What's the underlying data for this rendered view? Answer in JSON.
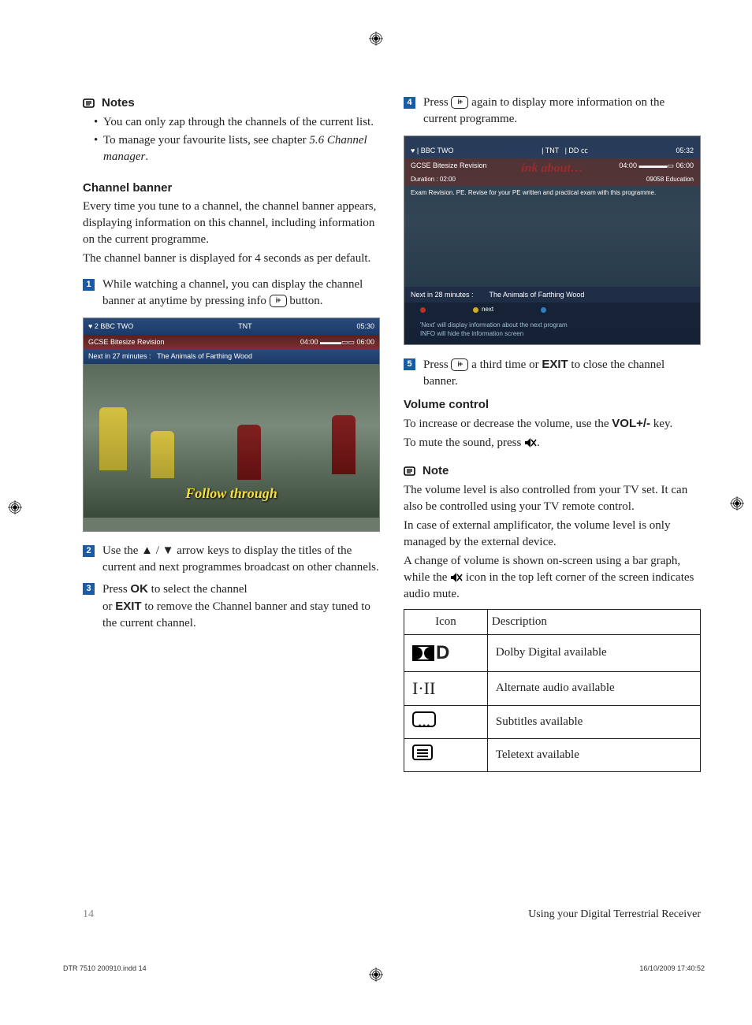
{
  "left": {
    "notesTitle": "Notes",
    "bullets": [
      "You can only zap through the channels of the current list.",
      "To manage your favourite lists, see chapter "
    ],
    "bulletRef": "5.6 Channel manager",
    "bannerHeading": "Channel banner",
    "bannerP1": "Every time you tune to a channel, the channel banner appears, displaying information on this channel, including information on the current programme.",
    "bannerP2": "The channel banner is displayed for 4 seconds as per default.",
    "step1_a": "While watching a channel, you can display the channel banner at anytime by pressing info ",
    "step1_b": " button.",
    "shot1": {
      "chLabel": "2 BBC TWO",
      "tnt": "TNT",
      "time": "05:30",
      "prog": "GCSE Bitesize Revision",
      "t1": "04:00",
      "t2": "06:00",
      "nextLabel": "Next in 27 minutes :",
      "nextProg": "The Animals of Farthing Wood",
      "follow": "Follow through"
    },
    "step2_a": "Use the ▲ / ▼ arrow keys to display the titles of the current and next programmes broadcast on other channels.",
    "step3_a": "Press ",
    "step3_ok": "OK",
    "step3_b": " to select the channel",
    "step3_c": "or ",
    "step3_exit": "EXIT",
    "step3_d": " to remove the Channel banner and stay tuned to the current channel."
  },
  "right": {
    "step4_a": "Press ",
    "step4_b": " again to display more information on the current programme.",
    "shot2": {
      "ch": "BBC TWO",
      "tnt": "TNT",
      "time": "05:32",
      "prog": "GCSE Bitesize Revision",
      "t1": "04:00",
      "t2": "06:00",
      "dur": "Duration :    02:00",
      "edu": "Education",
      "think": "ink about…",
      "desc": "Exam Revision. PE. Revise for your PE written and practical exam with this programme.",
      "nextIn": "Next in 28 minutes :",
      "nextProg": "The Animals of Farthing Wood",
      "nextBtn": "next",
      "hint1": "'Next' will display information about the next program",
      "hint2": "INFO will hide the information screen",
      "code": "09058"
    },
    "step5_a": "Press ",
    "step5_b": " a third time or ",
    "step5_exit": "EXIT",
    "step5_c": " to close the channel banner.",
    "volHeading": "Volume control",
    "volP1_a": "To increase or decrease the volume, use the ",
    "volKey": "VOL+/-",
    "volP1_b": " key.",
    "volP2_a": "To mute the sound, press ",
    "volP2_b": ".",
    "noteTitle": "Note",
    "noteP1": "The volume level is also controlled from your TV set. It can also be controlled using your TV remote control.",
    "noteP2": "In case of external amplificator, the volume level is only managed by the external device.",
    "noteP3_a": "A change of volume is shown on-screen using a bar graph, while the ",
    "noteP3_b": " icon in the top left corner of the screen indicates audio mute.",
    "table": {
      "h1": "Icon",
      "h2": "Description",
      "r1": "Dolby Digital available",
      "r2": "Alternate audio available",
      "r3": "Subtitles available",
      "r4": "Teletext available",
      "altAudio": "I·II"
    }
  },
  "footer": {
    "page": "14",
    "section": "Using your Digital Terrestrial Receiver"
  },
  "meta": {
    "file": "DTR 7510 200910.indd   14",
    "date": "16/10/2009   17:40:52"
  }
}
